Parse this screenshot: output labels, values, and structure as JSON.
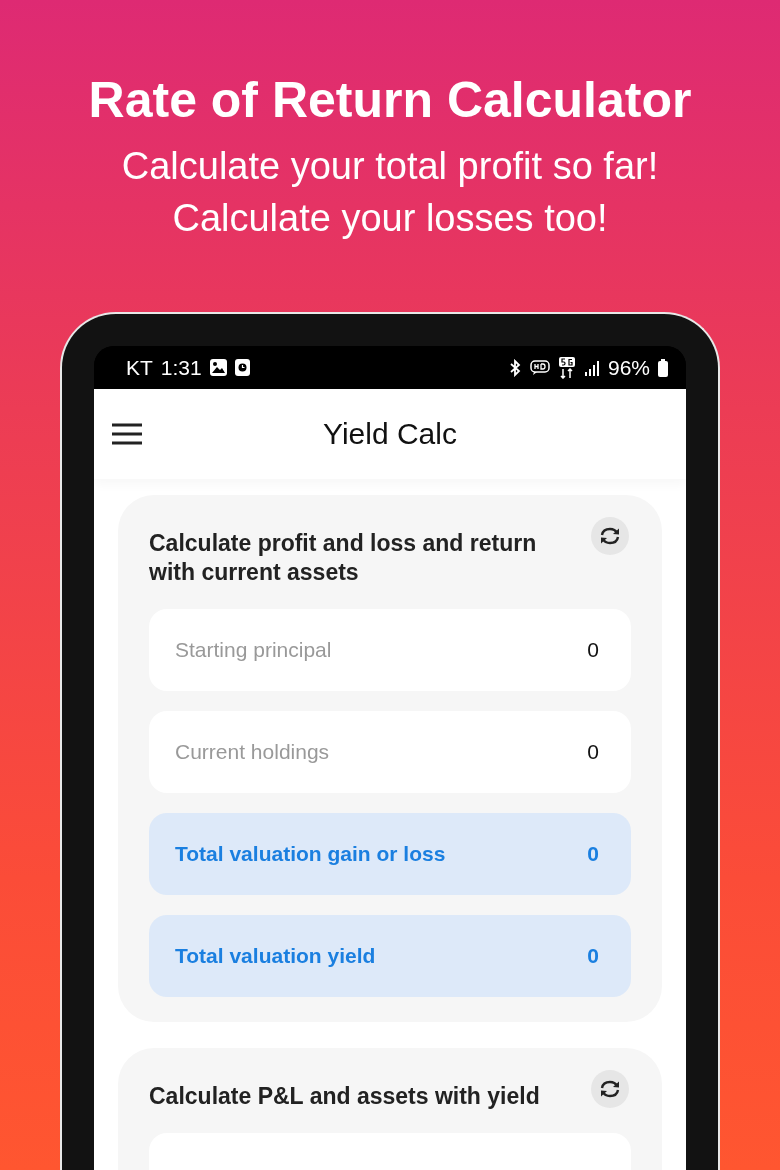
{
  "promo": {
    "title": "Rate of Return Calculator",
    "subtitle_lines": [
      "Calculate your total profit so far!",
      "Calculate your losses too!"
    ]
  },
  "status_bar": {
    "carrier": "KT",
    "time": "1:31",
    "battery": "96%"
  },
  "app_bar": {
    "title": "Yield Calc"
  },
  "cards": [
    {
      "heading": "Calculate profit and loss and return with current assets",
      "rows": [
        {
          "kind": "input",
          "placeholder": "Starting principal",
          "value": "0"
        },
        {
          "kind": "input",
          "placeholder": "Current holdings",
          "value": "0"
        },
        {
          "kind": "result",
          "label": "Total valuation gain or loss",
          "value": "0"
        },
        {
          "kind": "result",
          "label": "Total valuation yield",
          "value": "0"
        }
      ]
    },
    {
      "heading": "Calculate P&L and assets with yield",
      "rows": [
        {
          "kind": "input"
        }
      ]
    }
  ]
}
